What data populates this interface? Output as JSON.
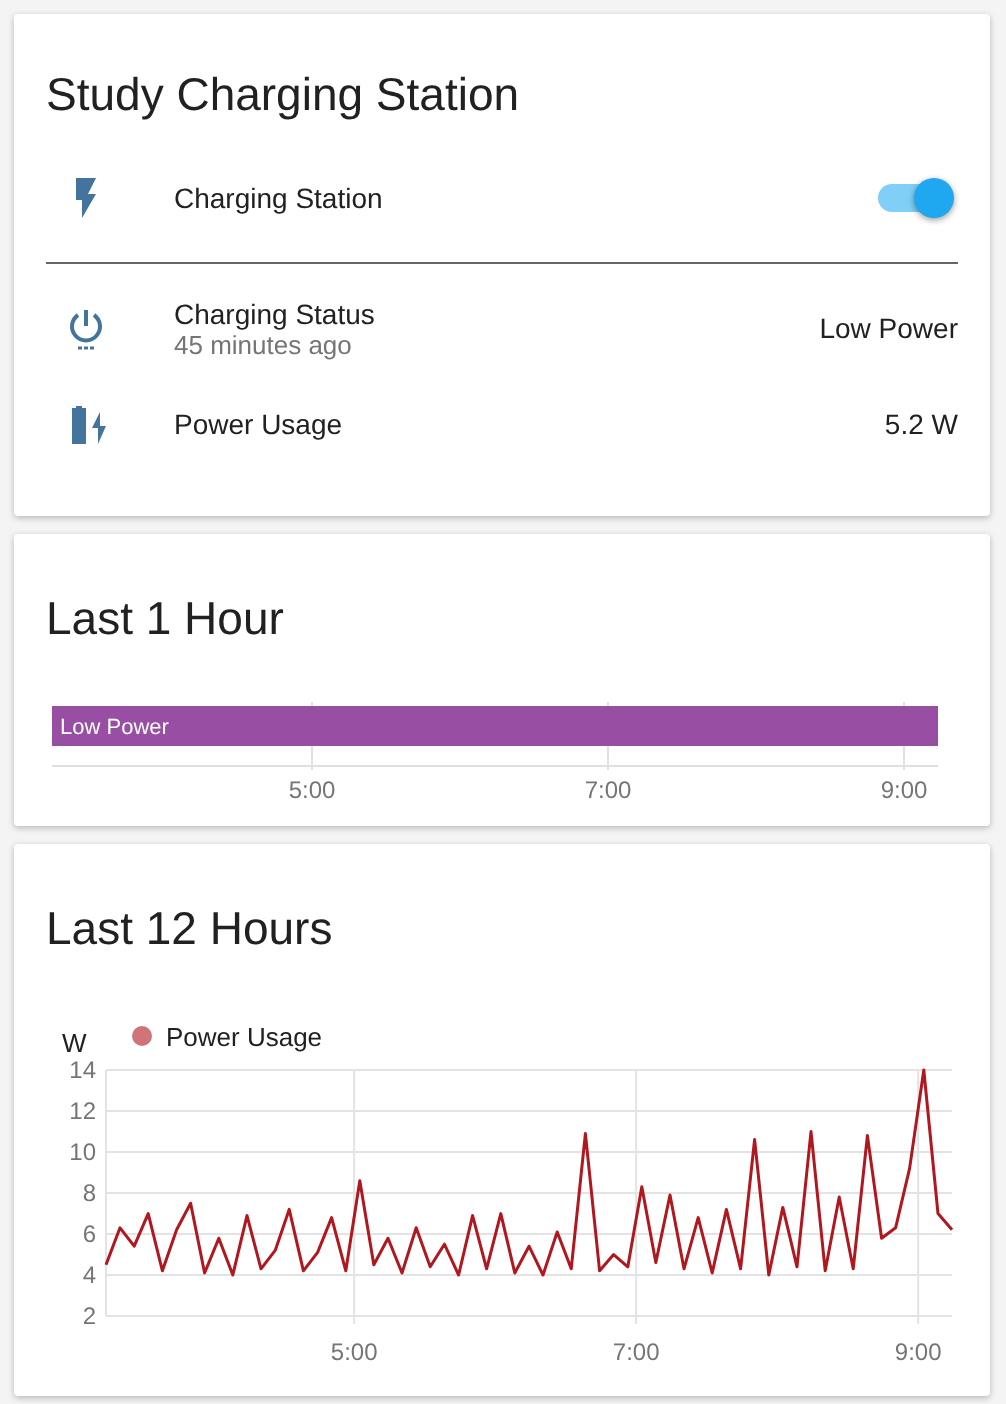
{
  "status_card": {
    "title": "Study Charging Station",
    "toggle_row": {
      "label": "Charging Station",
      "on": true
    },
    "rows": [
      {
        "kind": "status",
        "label": "Charging Status",
        "secondary": "45 minutes ago",
        "value": "Low Power"
      },
      {
        "kind": "battery",
        "label": "Power Usage",
        "value": "5.2 W"
      }
    ]
  },
  "timeline_card": {
    "title": "Last 1 Hour",
    "segments": [
      {
        "label": "Low Power",
        "color": "#984ea3"
      }
    ],
    "ticks": [
      "5:00",
      "7:00",
      "9:00"
    ]
  },
  "history_card": {
    "title": "Last 12 Hours",
    "chart_data": {
      "type": "line",
      "ylabel": "W",
      "xlim": [
        3.24,
        9.24
      ],
      "ylim": [
        2,
        14
      ],
      "xticks": [
        {
          "value": 5,
          "label": "5:00"
        },
        {
          "value": 7,
          "label": "7:00"
        },
        {
          "value": 9,
          "label": "9:00"
        }
      ],
      "yticks": [
        2,
        4,
        6,
        8,
        10,
        12,
        14
      ],
      "grid": true,
      "x": [
        3.24,
        3.34,
        3.44,
        3.54,
        3.64,
        3.74,
        3.84,
        3.94,
        4.04,
        4.14,
        4.24,
        4.34,
        4.44,
        4.54,
        4.64,
        4.74,
        4.84,
        4.94,
        5.04,
        5.14,
        5.24,
        5.34,
        5.44,
        5.54,
        5.64,
        5.74,
        5.84,
        5.94,
        6.04,
        6.14,
        6.24,
        6.34,
        6.44,
        6.54,
        6.64,
        6.74,
        6.84,
        6.94,
        7.04,
        7.14,
        7.24,
        7.34,
        7.44,
        7.54,
        7.64,
        7.74,
        7.84,
        7.94,
        8.04,
        8.14,
        8.24,
        8.34,
        8.44,
        8.54,
        8.64,
        8.74,
        8.84,
        8.94,
        9.04,
        9.14,
        9.24
      ],
      "series": [
        {
          "name": "Power Usage",
          "color": "#b0171f",
          "values": [
            4.5,
            6.3,
            5.4,
            7.0,
            4.2,
            6.2,
            7.5,
            4.1,
            5.8,
            4.0,
            6.9,
            4.3,
            5.2,
            7.2,
            4.2,
            5.1,
            6.8,
            4.2,
            8.6,
            4.5,
            5.8,
            4.1,
            6.3,
            4.4,
            5.5,
            4.0,
            6.9,
            4.3,
            7.0,
            4.1,
            5.4,
            4.0,
            6.1,
            4.3,
            10.9,
            4.2,
            5.0,
            4.4,
            8.3,
            4.6,
            7.9,
            4.3,
            6.8,
            4.1,
            7.2,
            4.3,
            10.6,
            4.0,
            7.3,
            4.4,
            11.0,
            4.2,
            7.8,
            4.3,
            10.8,
            5.8,
            6.3,
            9.2,
            14.0,
            7.0,
            6.2
          ]
        }
      ]
    }
  }
}
